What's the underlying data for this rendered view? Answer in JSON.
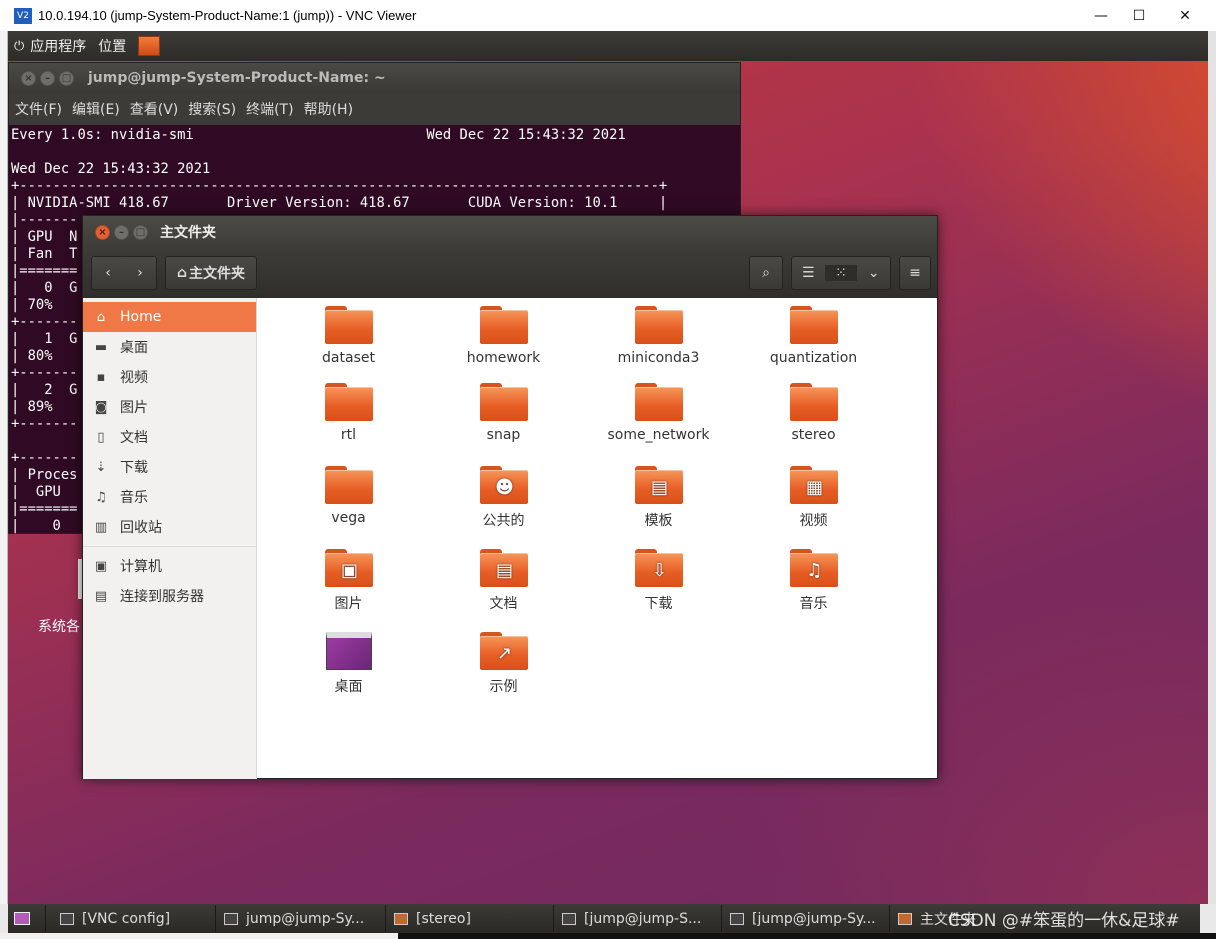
{
  "vnc": {
    "icon_text": "V2",
    "title": "10.0.194.10 (jump-System-Product-Name:1 (jump)) - VNC Viewer",
    "minimize": "—",
    "maximize": "☐",
    "close": "✕"
  },
  "top_panel": {
    "applications": "应用程序",
    "places": "位置"
  },
  "terminal": {
    "title": "jump@jump-System-Product-Name: ~",
    "menu": [
      "文件(F)",
      "编辑(E)",
      "查看(V)",
      "搜索(S)",
      "终端(T)",
      "帮助(H)"
    ],
    "lines": [
      "Every 1.0s: nvidia-smi                            Wed Dec 22 15:43:32 2021",
      "",
      "Wed Dec 22 15:43:32 2021",
      "+-----------------------------------------------------------------------------+",
      "| NVIDIA-SMI 418.67       Driver Version: 418.67       CUDA Version: 10.1     |",
      "|-------",
      "| GPU  N",
      "| Fan  T",
      "|=======",
      "|   0  G",
      "| 70%",
      "+-------",
      "|   1  G",
      "| 80%",
      "+-------",
      "|   2  G",
      "| 89%",
      "+-------",
      "",
      "+-------",
      "| Proces",
      "|  GPU",
      "|=======",
      "|    0"
    ]
  },
  "file_manager": {
    "title": "主文件夹",
    "location": "主文件夹",
    "sidebar": [
      {
        "label": "Home",
        "icon": "home-icon",
        "glyph": "⌂"
      },
      {
        "label": "桌面",
        "icon": "desktop-icon",
        "glyph": "▬"
      },
      {
        "label": "视频",
        "icon": "video-icon",
        "glyph": "▪"
      },
      {
        "label": "图片",
        "icon": "camera-icon",
        "glyph": "◙"
      },
      {
        "label": "文档",
        "icon": "document-icon",
        "glyph": "▯"
      },
      {
        "label": "下载",
        "icon": "download-icon",
        "glyph": "⇣"
      },
      {
        "label": "音乐",
        "icon": "music-icon",
        "glyph": "♫"
      },
      {
        "label": "回收站",
        "icon": "trash-icon",
        "glyph": "▥"
      },
      {
        "label": "计算机",
        "icon": "computer-icon",
        "glyph": "▣"
      },
      {
        "label": "连接到服务器",
        "icon": "server-icon",
        "glyph": "▤"
      }
    ],
    "items": [
      {
        "label": "dataset",
        "emblem": ""
      },
      {
        "label": "homework",
        "emblem": ""
      },
      {
        "label": "miniconda3",
        "emblem": ""
      },
      {
        "label": "quantization",
        "emblem": ""
      },
      {
        "label": "rtl",
        "emblem": ""
      },
      {
        "label": "snap",
        "emblem": ""
      },
      {
        "label": "some_network",
        "emblem": ""
      },
      {
        "label": "stereo",
        "emblem": ""
      },
      {
        "label": "vega",
        "emblem": ""
      },
      {
        "label": "公共的",
        "emblem": "☻"
      },
      {
        "label": "模板",
        "emblem": "▤"
      },
      {
        "label": "视频",
        "emblem": "▦"
      },
      {
        "label": "图片",
        "emblem": "▣"
      },
      {
        "label": "文档",
        "emblem": "▤"
      },
      {
        "label": "下载",
        "emblem": "⇩"
      },
      {
        "label": "音乐",
        "emblem": "♫"
      },
      {
        "label": "桌面",
        "emblem": ""
      },
      {
        "label": "示例",
        "emblem": "↗"
      }
    ]
  },
  "desktop": {
    "icon_label": "系统各"
  },
  "taskbar": {
    "items": [
      "[VNC config]",
      "jump@jump-Sy...",
      "[stereo]",
      "[jump@jump-S...",
      "[jump@jump-Sy...",
      "主文件夹"
    ]
  },
  "watermark": "CSDN @#笨蛋的一休&足球#"
}
